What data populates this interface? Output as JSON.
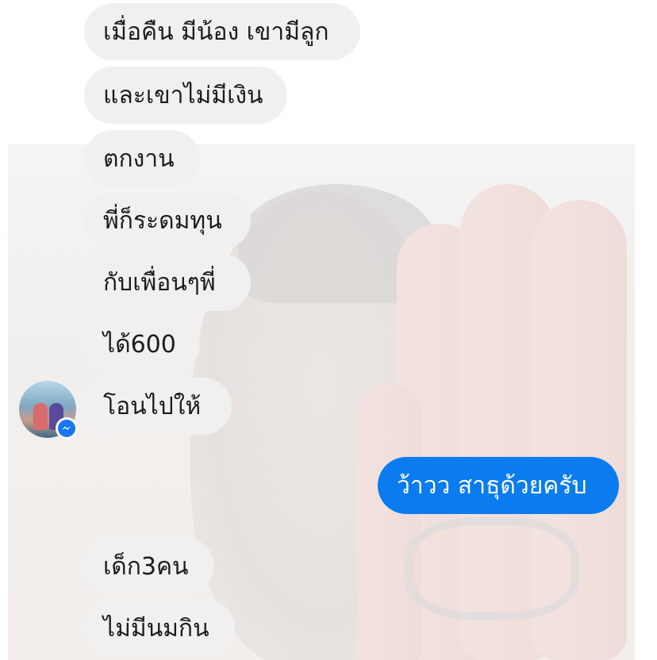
{
  "conversation": {
    "messages_top": [
      {
        "text": "เมื่อคืน มีน้อง เขามีลูก"
      },
      {
        "text": "และเขาไม่มีเงิน"
      },
      {
        "text": "ตกงาน"
      },
      {
        "text": "พี่ก็ระดมทุน"
      },
      {
        "text": "กับเพื่อนๆพี่"
      },
      {
        "text": "ได้600"
      },
      {
        "text": "โอนไปให้"
      }
    ],
    "sent_message": {
      "text": "ว้าวว สาธุด้วยครับ"
    },
    "messages_bottom": [
      {
        "text": "เด็ก3คน"
      },
      {
        "text": "ไม่มีนมกิน"
      }
    ]
  },
  "colors": {
    "received_bubble": "#f0f0f0",
    "sent_bubble": "#0a7cf0",
    "messenger_accent": "#1877f2"
  },
  "icons": {
    "avatar": "contact-avatar-photo",
    "badge": "messenger-icon"
  }
}
